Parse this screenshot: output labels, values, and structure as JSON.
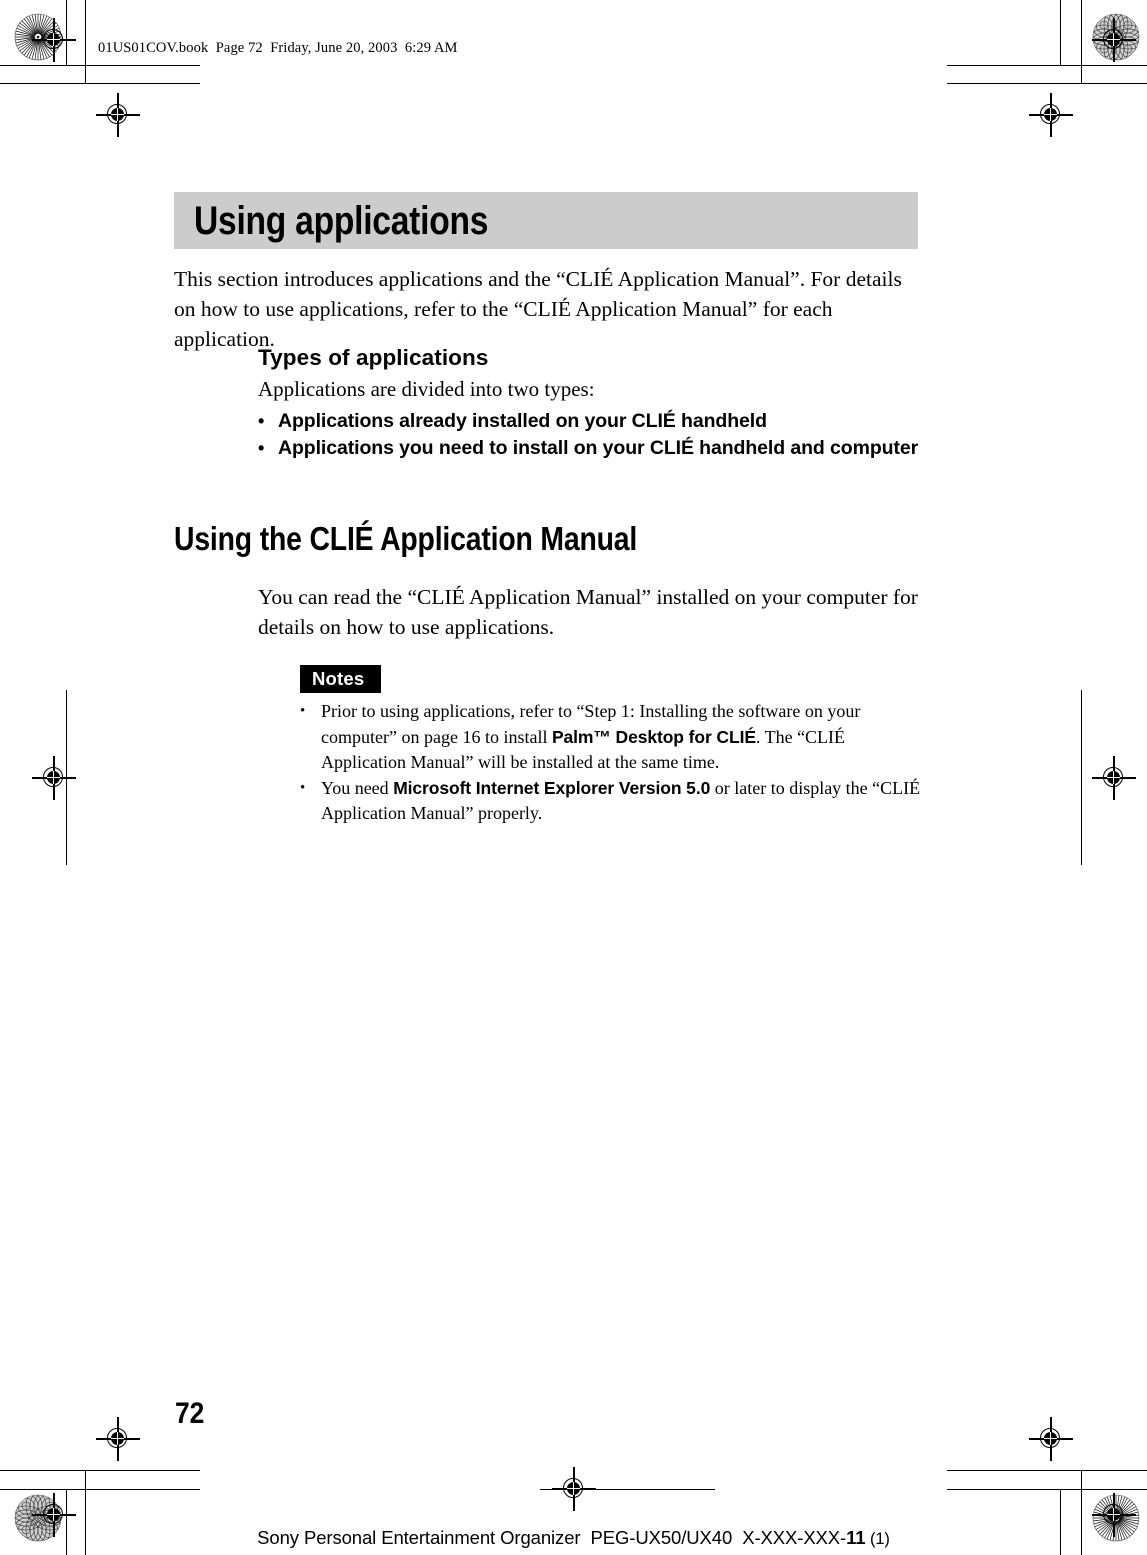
{
  "page": {
    "running_head": "01US01COV.book  Page 72  Friday, June 20, 2003  6:29 AM",
    "folio": "72",
    "banner_color": "#cccccc"
  },
  "banner": {
    "title": "Using applications"
  },
  "intro": {
    "paragraph": "This section introduces applications and the “CLIÉ Application Manual”. For details on how to use applications, refer to the “CLIÉ Application Manual” for each application."
  },
  "types_section": {
    "heading": "Types of applications",
    "lead": "Applications are divided into two types:",
    "bullet_marker": "•",
    "items": [
      "Applications already installed on your CLIÉ handheld",
      "Applications you need to install on your CLIÉ handheld and computer"
    ]
  },
  "manual_section": {
    "heading": "Using the CLIÉ Application Manual",
    "paragraph": "You can read the “CLIÉ Application Manual” installed on your computer for details on how to use applications."
  },
  "notes": {
    "badge_label": "Notes",
    "bullet_marker": "•",
    "items": [
      {
        "part1": "Prior to using applications, refer to “Step 1: Installing the software on your computer” on page 16 to install ",
        "emphasis": "Palm™ Desktop for CLIÉ",
        "part2": ". The “CLIÉ Application Manual” will be installed at the same time."
      },
      {
        "part1": "You need ",
        "emphasis": "Microsoft Internet Explorer Version 5.0",
        "part2": " or later to display the “CLIÉ Application Manual” properly."
      }
    ]
  },
  "footer": {
    "text": "Sony Personal Entertainment Organizer  PEG-UX50/UX40  X-XXX-XXX-",
    "bold_code": "11",
    "suffix": " (1)"
  }
}
